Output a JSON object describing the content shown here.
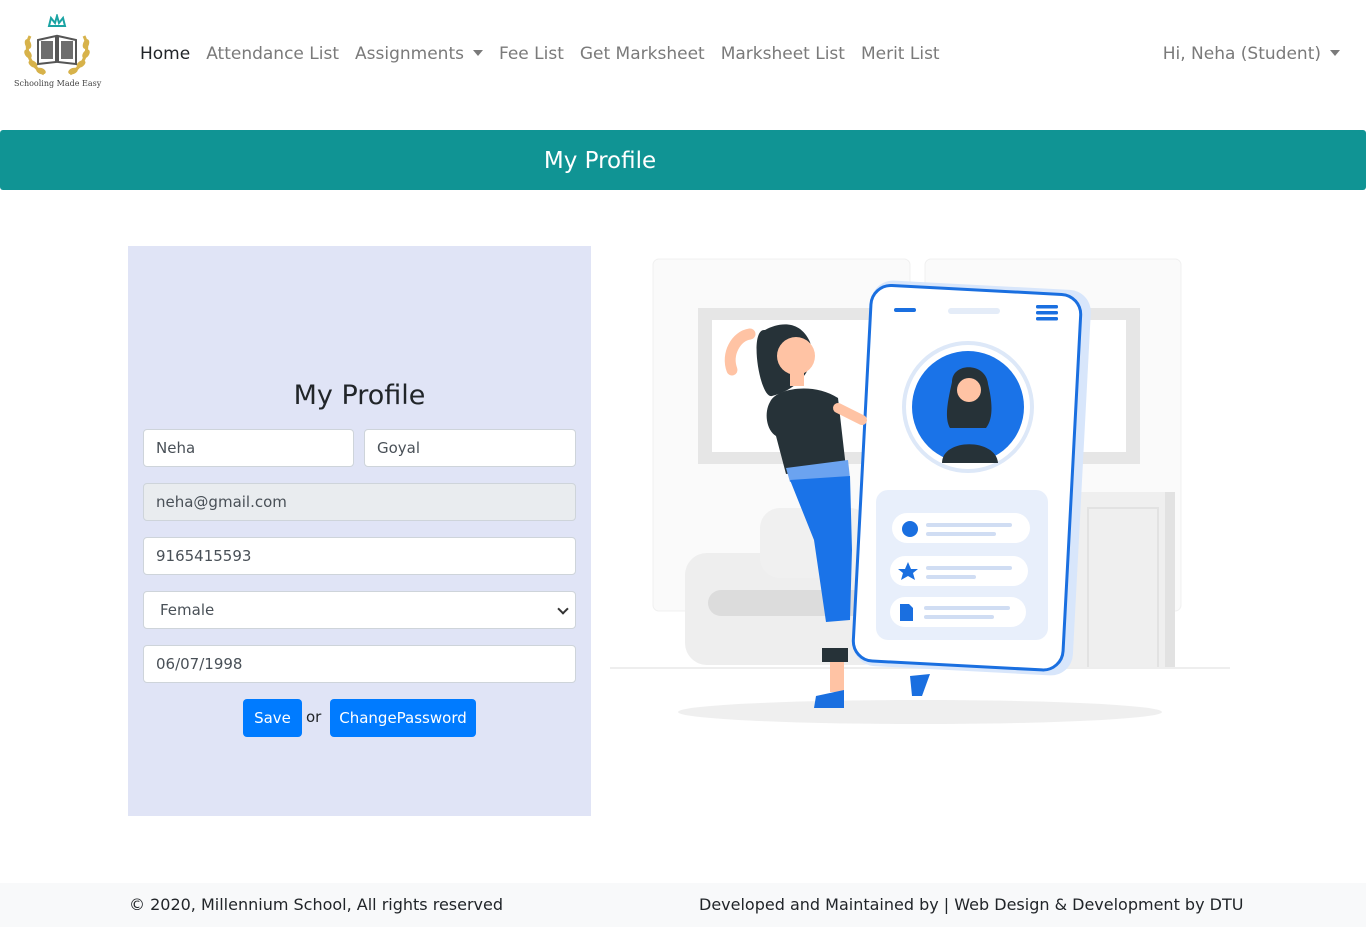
{
  "brand": {
    "logo_icon": "open-book-laurel-crown-logo",
    "caption": "Schooling Made Easy"
  },
  "nav": {
    "items": [
      {
        "label": "Home",
        "active": true
      },
      {
        "label": "Attendance List",
        "active": false
      },
      {
        "label": "Assignments",
        "active": false,
        "dropdown": true
      },
      {
        "label": "Fee List",
        "active": false
      },
      {
        "label": "Get Marksheet",
        "active": false
      },
      {
        "label": "Marksheet List",
        "active": false
      },
      {
        "label": "Merit List",
        "active": false
      }
    ],
    "user_label": "Hi, Neha (Student)"
  },
  "banner": {
    "title": "My Profile",
    "color": "#109494"
  },
  "profile": {
    "title": "My Profile",
    "first_name": "Neha",
    "last_name": "Goyal",
    "email": "neha@gmail.com",
    "phone": "9165415593",
    "gender": "Female",
    "dob": "06/07/1998",
    "save_label": "Save",
    "or_text": "or",
    "change_password_label": "ChangePassword",
    "card_color": "#e0e4f6",
    "button_color": "#007bff"
  },
  "illustration": {
    "icon": "woman-with-phone-profile-illustration"
  },
  "footer": {
    "left": "© 2020, Millennium School, All rights reserved",
    "right": "Developed and Maintained by | Web Design & Development by DTU"
  }
}
